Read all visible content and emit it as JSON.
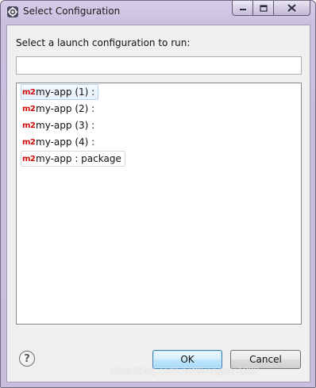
{
  "window": {
    "title": "Select Configuration",
    "title_icon": "eclipse-gear-icon",
    "caption_buttons": [
      "minimize-icon",
      "maximize-icon",
      "close-icon"
    ]
  },
  "dialog": {
    "prompt": "Select a launch configuration to run:",
    "filter": {
      "value": "",
      "placeholder": ""
    },
    "items": [
      {
        "icon_text": "m2",
        "label": "my-app (1) :"
      },
      {
        "icon_text": "m2",
        "label": "my-app (2) :"
      },
      {
        "icon_text": "m2",
        "label": "my-app (3) :"
      },
      {
        "icon_text": "m2",
        "label": "my-app (4) :"
      },
      {
        "icon_text": "m2",
        "label": "my-app : package"
      }
    ],
    "help_label": "?",
    "ok_label": "OK",
    "cancel_label": "Cancel"
  },
  "watermark": "https://blog.csdn.net/liyongyan1202",
  "colors": {
    "m2_icon": "#d10a0a",
    "ok_border": "#3c7fb1",
    "selection_border": "#b9d4ee"
  }
}
